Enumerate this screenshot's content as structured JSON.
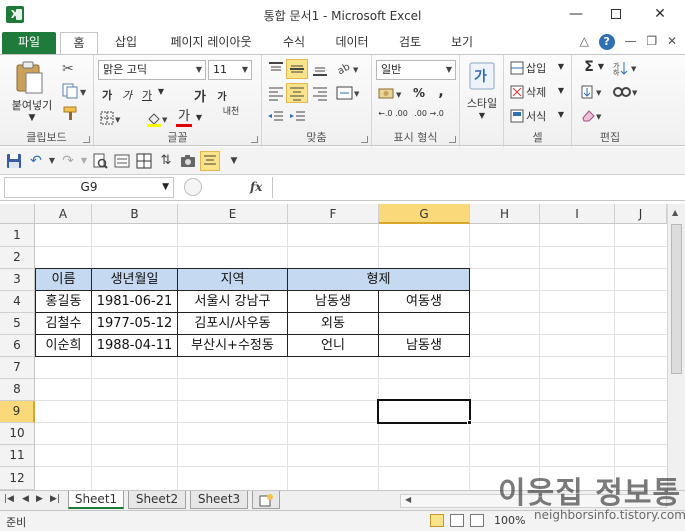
{
  "window": {
    "title": "통합 문서1 - Microsoft Excel",
    "min_glyph": "—",
    "close_glyph": "✕"
  },
  "ribbon_tabs": [
    "파일",
    "홈",
    "삽입",
    "페이지 레이아웃",
    "수식",
    "데이터",
    "검토",
    "보기"
  ],
  "ribbon": {
    "clipboard": {
      "paste": "붙여넣기",
      "label": "클립보드"
    },
    "font": {
      "name": "맑은 고딕",
      "size": "11",
      "label": "글꼴",
      "bold": "가",
      "italic": "가",
      "underline": "가",
      "grow": "가",
      "shrink": "가",
      "font_color": "가",
      "phonetic": "내천"
    },
    "alignment": {
      "label": "맞춤"
    },
    "number": {
      "format": "일반",
      "label": "표시 형식",
      "percent": "%",
      "comma": ",",
      "inc_decimal": "←.0 .00",
      "dec_decimal": ".00 →.0"
    },
    "styles": {
      "label": "스타일"
    },
    "cells": {
      "insert": "삽입",
      "delete": "삭제",
      "format": "서식",
      "label": "셀"
    },
    "editing": {
      "label": "편집"
    }
  },
  "formula_bar": {
    "name_box": "G9",
    "fx": "fx",
    "value": ""
  },
  "columns": [
    "A",
    "B",
    "E",
    "F",
    "G",
    "H",
    "I",
    "J"
  ],
  "active_column": "G",
  "rows": [
    "1",
    "2",
    "3",
    "4",
    "5",
    "6",
    "7",
    "8",
    "9",
    "10",
    "11",
    "12"
  ],
  "active_row": "9",
  "table": {
    "header": [
      "이름",
      "생년월일",
      "지역",
      "형제"
    ],
    "rows": [
      [
        "홍길동",
        "1981-06-21",
        "서울시 강남구",
        "남동생",
        "여동생"
      ],
      [
        "김철수",
        "1977-05-12",
        "김포시/사우동",
        "외동",
        ""
      ],
      [
        "이순희",
        "1988-04-11",
        "부산시+수정동",
        "언니",
        "남동생"
      ]
    ]
  },
  "sheets": [
    "Sheet1",
    "Sheet2",
    "Sheet3"
  ],
  "active_sheet": "Sheet1",
  "status": {
    "text": "준비",
    "zoom": "100%"
  },
  "watermark": {
    "title": "이웃집 정보통",
    "url": "neighborsinfo.tistory.com"
  },
  "colors": {
    "accent": "#1e7b3b",
    "header_fill": "#c5d9f1",
    "active_header": "#f9d97a"
  }
}
